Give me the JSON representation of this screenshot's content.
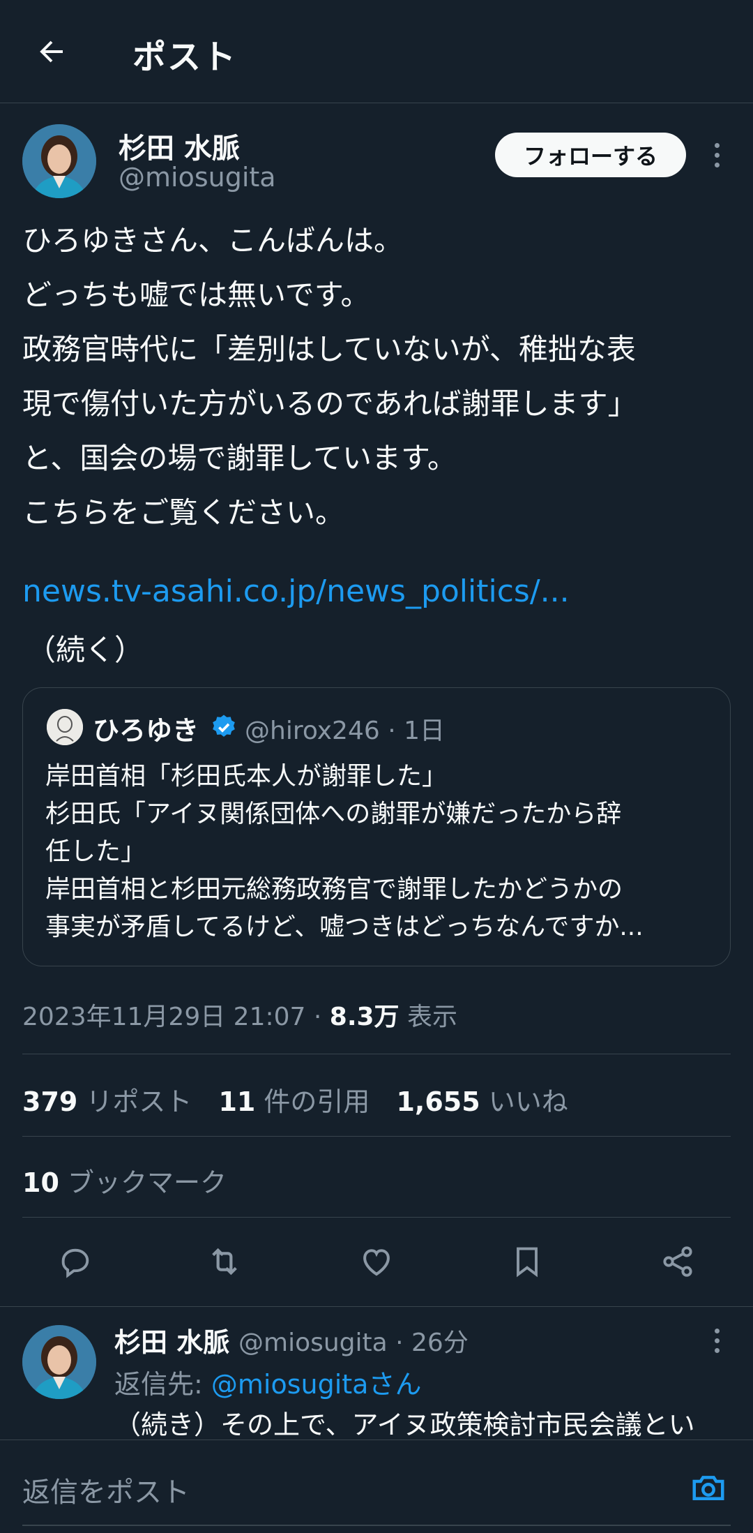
{
  "header": {
    "title": "ポスト"
  },
  "tweet": {
    "author_name": "杉田 水脈",
    "author_handle": "@miosugita",
    "follow_label": "フォローする",
    "body": "ひろゆきさん、こんばんは。\nどっちも嘘では無いです。\n政務官時代に「差別はしていないが、稚拙な表\n現で傷付いた方がいるのであれば謝罪します」\nと、国会の場で謝罪しています。\nこちらをご覧ください。",
    "link": "news.tv-asahi.co.jp/news_politics/...",
    "continued": "（続く）"
  },
  "quote": {
    "name": "ひろゆき",
    "meta": "@hirox246 · 1日",
    "text": "岸田首相「杉田氏本人が謝罪した」\n杉田氏「アイヌ関係団体への謝罪が嫌だったから辞\n任した」\n岸田首相と杉田元総務政務官で謝罪したかどうかの\n事実が矛盾してるけど、嘘つきはどっちなんですか..."
  },
  "meta": {
    "timestamp": "2023年11月29日 21:07 · ",
    "views_count": "8.3万",
    "views_label": " 表示"
  },
  "stats": {
    "reposts_count": "379",
    "reposts_label": "リポスト",
    "quotes_count": "11",
    "quotes_label": "件の引用",
    "likes_count": "1,655",
    "likes_label": "いいね",
    "bookmarks_count": "10",
    "bookmarks_label": "ブックマーク"
  },
  "reply": {
    "author_name": "杉田 水脈",
    "meta": "@miosugita · 26分",
    "reply_to_prefix": "返信先: ",
    "reply_to_handle": "@miosugitaさん",
    "text": "（続き）その上で、アイヌ政策検討市民会議とい"
  },
  "compose": {
    "placeholder": "返信をポスト"
  },
  "colors": {
    "background": "#15202b",
    "accent": "#1d9bf0",
    "muted": "#8b98a5",
    "border": "#38444d"
  },
  "icons": [
    "back-arrow-icon",
    "more-icon",
    "verified-icon",
    "reply-icon",
    "repost-icon",
    "like-icon",
    "bookmark-icon",
    "share-icon",
    "camera-icon"
  ]
}
